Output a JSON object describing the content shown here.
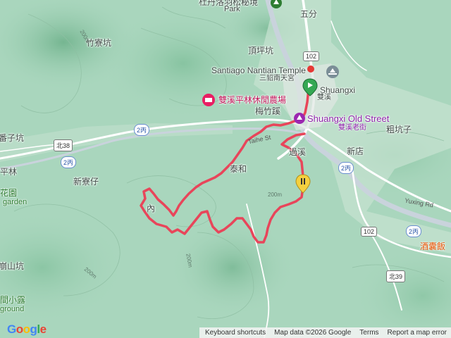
{
  "places": {
    "top_park": "杜丹洛羽松秘境",
    "top_park_en": "Park",
    "wufen": "五分",
    "zhuliaokeng": "竹寮坑",
    "dingpingkeng": "頂坪坑",
    "santiago": "Santiago Nantian Temple",
    "santiago_zh": "三貂南天宮",
    "shuangxi": "Shuangxi",
    "shuangxi_zh": "雙溪",
    "farm": "雙溪平林休閒農場",
    "meizhuxi": "梅竹蹊",
    "old_street": "Shuangxi Old Street",
    "old_street_zh": "雙溪老街",
    "cukengzi": "粗坑子",
    "fanzikeng": "番子坑",
    "pinglin": "平林",
    "garden": "花園",
    "garden_en": "garden",
    "xinliaozi": "新寮仔",
    "taihe": "泰和",
    "guoxi": "過溪",
    "xindian": "新店",
    "nei": "內",
    "yuxing_rd": "Yuxing Rd",
    "taihe_st": "Taihe St",
    "restaurant": "酒囊飯",
    "lingshankeng": "崩山坑",
    "camp": "間小露",
    "camp_en": "ground",
    "elev_200": "200m"
  },
  "shields": {
    "r102": "102",
    "r2bing": "2丙",
    "north38": "北38",
    "north39": "北39"
  },
  "footer": {
    "logo": "Google",
    "shortcuts": "Keyboard shortcuts",
    "map_data": "Map data ©2026 Google",
    "terms": "Terms",
    "report": "Report a map error"
  },
  "colors": {
    "terrain": "#a9d6bd",
    "route": "#e8455a",
    "start_marker": "#34a853",
    "end_marker": "#f4d03f",
    "river": "#c9d3dc"
  }
}
